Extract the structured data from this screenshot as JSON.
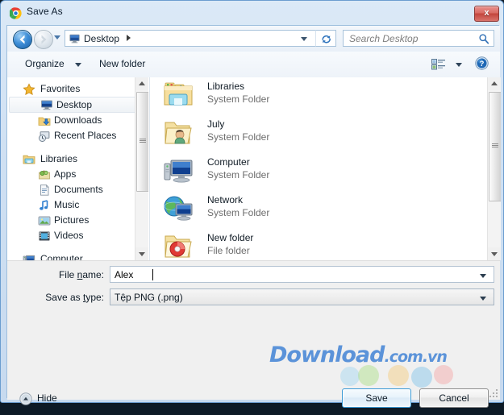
{
  "window": {
    "title": "Save As",
    "app_icon": "chrome-logo-icon",
    "close_label": "x",
    "accent_blue": "#3c9bd6",
    "frame_border": "#6b9dd0"
  },
  "addressbar": {
    "back_icon": "back-arrow-icon",
    "forward_icon": "forward-arrow-icon",
    "recent_pages_icon": "chevron-down-icon",
    "breadcrumb": {
      "icon": "desktop-monitor-icon",
      "path": "Desktop",
      "separator": "chevron-right-icon",
      "dropdown_icon": "chevron-down-icon"
    },
    "refresh_icon": "refresh-icon",
    "search": {
      "placeholder": "Search Desktop",
      "icon": "search-icon"
    }
  },
  "commandbar": {
    "organize_label": "Organize",
    "organize_caret": "chevron-down-icon",
    "new_folder_label": "New folder",
    "view_icon": "change-view-icon",
    "view_caret": "chevron-down-icon",
    "help_icon": "help-question-icon"
  },
  "navpane": {
    "groups": [
      {
        "header": {
          "label": "Favorites",
          "icon": "star-icon"
        },
        "items": [
          {
            "label": "Desktop",
            "icon": "desktop-monitor-icon",
            "selected": true
          },
          {
            "label": "Downloads",
            "icon": "downloads-folder-icon",
            "selected": false
          },
          {
            "label": "Recent Places",
            "icon": "recent-places-icon",
            "selected": false
          }
        ]
      },
      {
        "header": {
          "label": "Libraries",
          "icon": "libraries-icon"
        },
        "items": [
          {
            "label": "Apps",
            "icon": "apps-library-icon",
            "selected": false
          },
          {
            "label": "Documents",
            "icon": "documents-library-icon",
            "selected": false
          },
          {
            "label": "Music",
            "icon": "music-library-icon",
            "selected": false
          },
          {
            "label": "Pictures",
            "icon": "pictures-library-icon",
            "selected": false
          },
          {
            "label": "Videos",
            "icon": "videos-library-icon",
            "selected": false
          }
        ]
      },
      {
        "header": {
          "label": "Computer",
          "icon": "computer-icon"
        },
        "items": []
      }
    ],
    "scrollbar": {
      "up_icon": "scroll-up-arrow-icon",
      "down_icon": "scroll-down-arrow-icon"
    }
  },
  "filelist": {
    "items": [
      {
        "name": "Libraries",
        "type": "System Folder",
        "icon": "libraries-folder-icon"
      },
      {
        "name": "July",
        "type": "System Folder",
        "icon": "user-folder-icon"
      },
      {
        "name": "Computer",
        "type": "System Folder",
        "icon": "computer-icon"
      },
      {
        "name": "Network",
        "type": "System Folder",
        "icon": "network-globe-icon"
      },
      {
        "name": "New folder",
        "type": "File folder",
        "icon": "folder-with-disc-icon"
      }
    ],
    "scrollbar": {
      "up_icon": "scroll-up-arrow-icon",
      "down_icon": "scroll-down-arrow-icon"
    }
  },
  "form": {
    "filename_label": "File name:",
    "filename_label_pre": "File ",
    "filename_label_underlined": "n",
    "filename_label_post": "ame:",
    "filename_value": "Alex",
    "filename_dropdown_icon": "chevron-down-icon",
    "savetype_label": "Save as type:",
    "savetype_label_pre": "Save as ",
    "savetype_label_underlined": "t",
    "savetype_label_post": "ype:",
    "savetype_value": "Tệp PNG (.png)",
    "savetype_dropdown_icon": "chevron-down-icon"
  },
  "footer": {
    "hide_folders_label": "Hide Folders",
    "hide_folders_icon": "collapse-up-icon",
    "save_label": "Save",
    "cancel_label": "Cancel",
    "resize_grip_icon": "resize-grip-icon"
  },
  "watermark": {
    "main": "Download",
    "suffix": ".com.vn",
    "color": "#3b7fd4"
  }
}
